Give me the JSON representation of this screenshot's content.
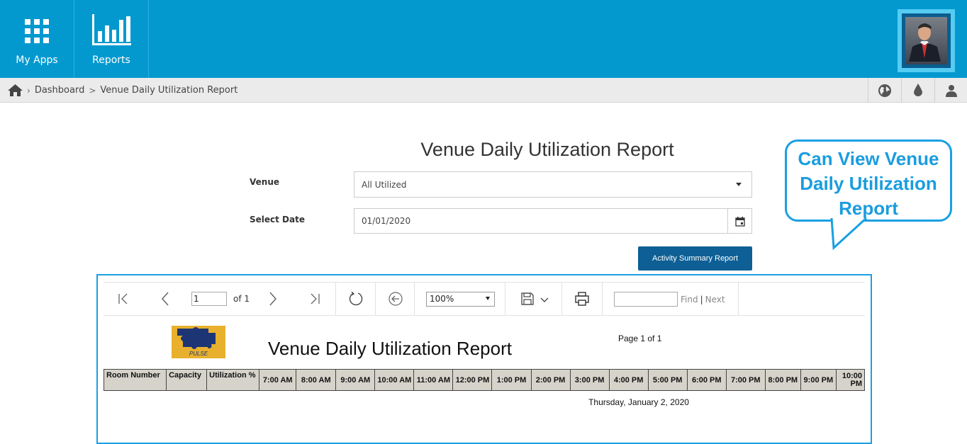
{
  "topbar": {
    "apps_label": "My Apps",
    "reports_label": "Reports",
    "apps_icon": "grid-icon",
    "reports_icon": "bar-chart-icon",
    "color": "#0399cf"
  },
  "breadcrumb": {
    "home_icon": "home-icon",
    "items": [
      "Dashboard",
      "Venue Daily Utilization Report"
    ],
    "right_icons": [
      "globe-icon",
      "drop-icon",
      "user-icon"
    ]
  },
  "form": {
    "title": "Venue Daily Utilization Report",
    "venue_label": "Venue",
    "venue_value": "All Utilized",
    "date_label": "Select Date",
    "date_value": "01/01/2020",
    "submit_label": "Activity Summary Report"
  },
  "callout": {
    "lines": [
      "Can View Venue",
      "Daily Utilization",
      "Report"
    ]
  },
  "viewer": {
    "page_value": "1",
    "page_of": "of 1",
    "zoom": "100%",
    "find_label": "Find",
    "next_label": "Next",
    "report_title": "Venue Daily Utilization Report",
    "page_text": "Page 1 of 1",
    "logo_text": "PULSE",
    "columns": [
      "Room Number",
      "Capacity",
      "Utilization %",
      "7:00 AM",
      "8:00 AM",
      "9:00 AM",
      "10:00 AM",
      "11:00 AM",
      "12:00 PM",
      "1:00 PM",
      "2:00 PM",
      "3:00 PM",
      "4:00 PM",
      "5:00 PM",
      "6:00 PM",
      "7:00 PM",
      "8:00 PM",
      "9:00 PM",
      "10:00 PM"
    ],
    "date_text": "Thursday, January 2, 2020"
  }
}
